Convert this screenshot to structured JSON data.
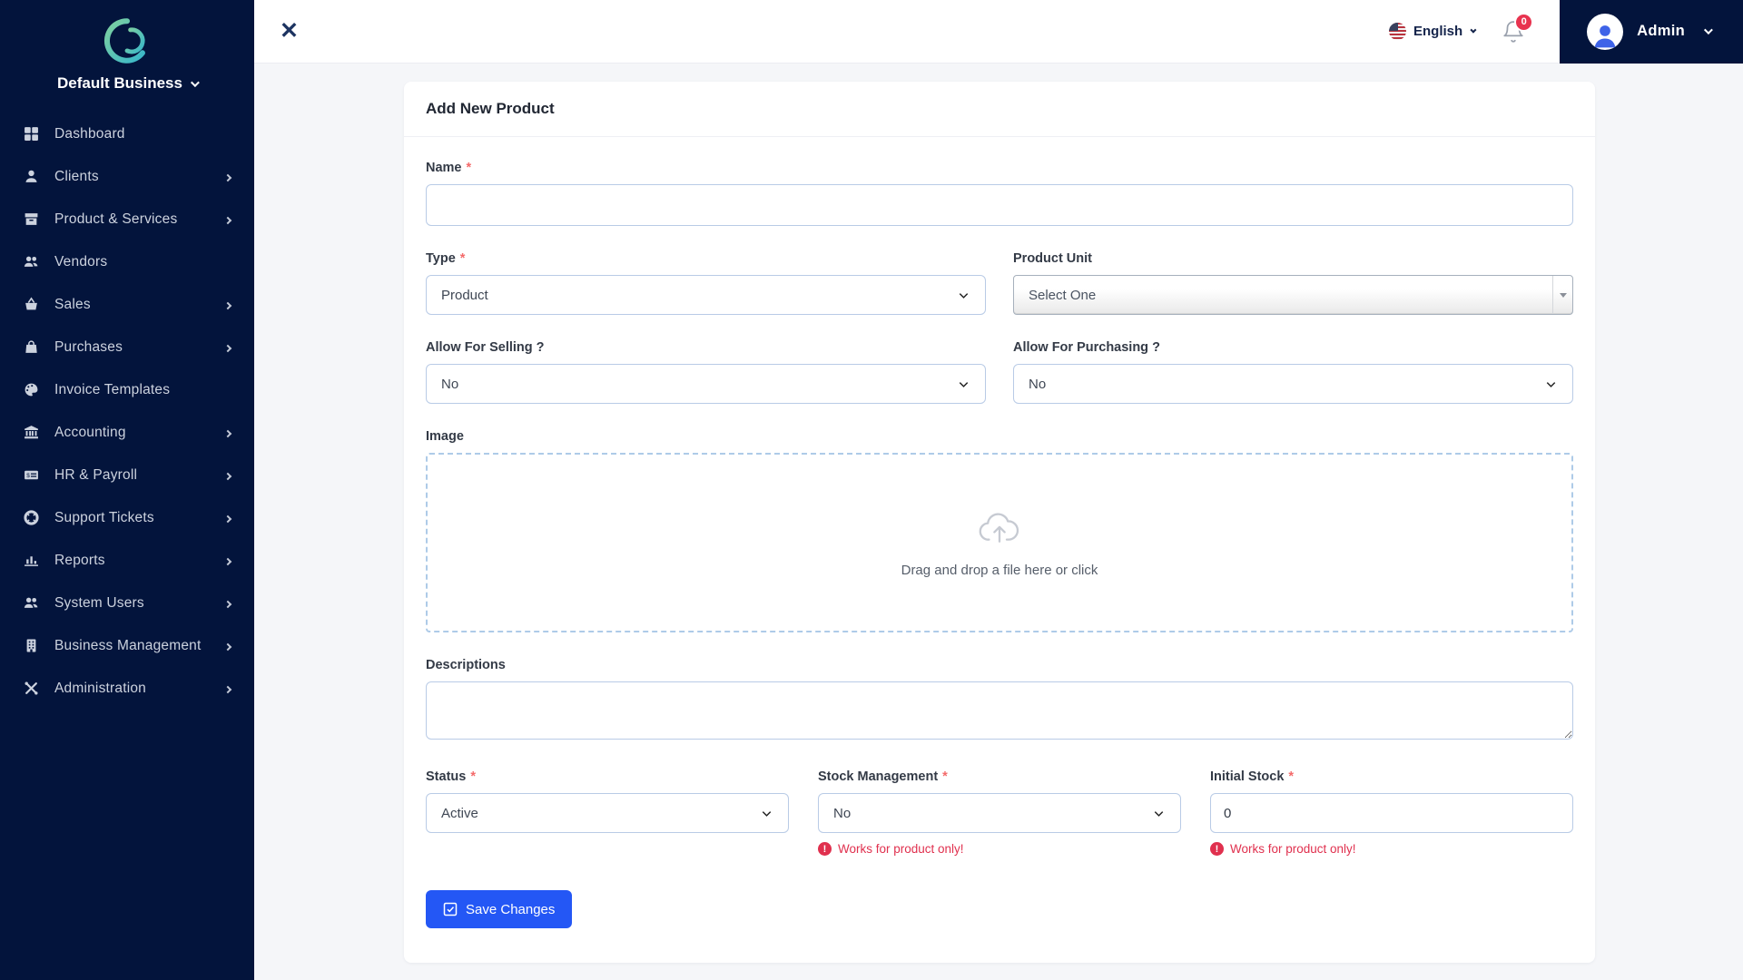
{
  "sidebar": {
    "business_name": "Default Business",
    "items": [
      {
        "label": "Dashboard",
        "icon": "grid-icon",
        "has_submenu": false
      },
      {
        "label": "Clients",
        "icon": "user-icon",
        "has_submenu": true
      },
      {
        "label": "Product & Services",
        "icon": "box-icon",
        "has_submenu": true
      },
      {
        "label": "Vendors",
        "icon": "users-icon",
        "has_submenu": false
      },
      {
        "label": "Sales",
        "icon": "basket-icon",
        "has_submenu": true
      },
      {
        "label": "Purchases",
        "icon": "bag-icon",
        "has_submenu": true
      },
      {
        "label": "Invoice Templates",
        "icon": "palette-icon",
        "has_submenu": false
      },
      {
        "label": "Accounting",
        "icon": "bank-icon",
        "has_submenu": true
      },
      {
        "label": "HR & Payroll",
        "icon": "payroll-icon",
        "has_submenu": true
      },
      {
        "label": "Support Tickets",
        "icon": "lifebuoy-icon",
        "has_submenu": true
      },
      {
        "label": "Reports",
        "icon": "bar-chart-icon",
        "has_submenu": true
      },
      {
        "label": "System Users",
        "icon": "users-icon",
        "has_submenu": true
      },
      {
        "label": "Business Management",
        "icon": "building-icon",
        "has_submenu": true
      },
      {
        "label": "Administration",
        "icon": "tools-icon",
        "has_submenu": true
      }
    ]
  },
  "topbar": {
    "language": {
      "label": "English"
    },
    "notifications": {
      "count": "0"
    },
    "user": {
      "name": "Admin"
    }
  },
  "form": {
    "title": "Add New Product",
    "required_mark": "*",
    "fields": {
      "name": {
        "label": "Name",
        "value": ""
      },
      "type": {
        "label": "Type",
        "value": "Product"
      },
      "product_unit": {
        "label": "Product Unit",
        "value": "Select One"
      },
      "allow_selling": {
        "label": "Allow For Selling ?",
        "value": "No"
      },
      "allow_purchasing": {
        "label": "Allow For Purchasing ?",
        "value": "No"
      },
      "image": {
        "label": "Image",
        "dropzone_text": "Drag and drop a file here or click"
      },
      "descriptions": {
        "label": "Descriptions",
        "value": ""
      },
      "status": {
        "label": "Status",
        "value": "Active"
      },
      "stock_management": {
        "label": "Stock Management",
        "value": "No",
        "hint": "Works for product only!"
      },
      "initial_stock": {
        "label": "Initial Stock",
        "value": "0",
        "hint": "Works for product only!"
      }
    },
    "save_label": "Save Changes"
  },
  "colors": {
    "sidebar_bg": "#03143c",
    "accent_blue": "#2457f5",
    "danger_red": "#e0304e",
    "input_border": "#b9cbe6",
    "badge_red": "#e8334f",
    "logo_gradient_start": "#7ed0a0",
    "logo_gradient_end": "#39b7c9"
  }
}
